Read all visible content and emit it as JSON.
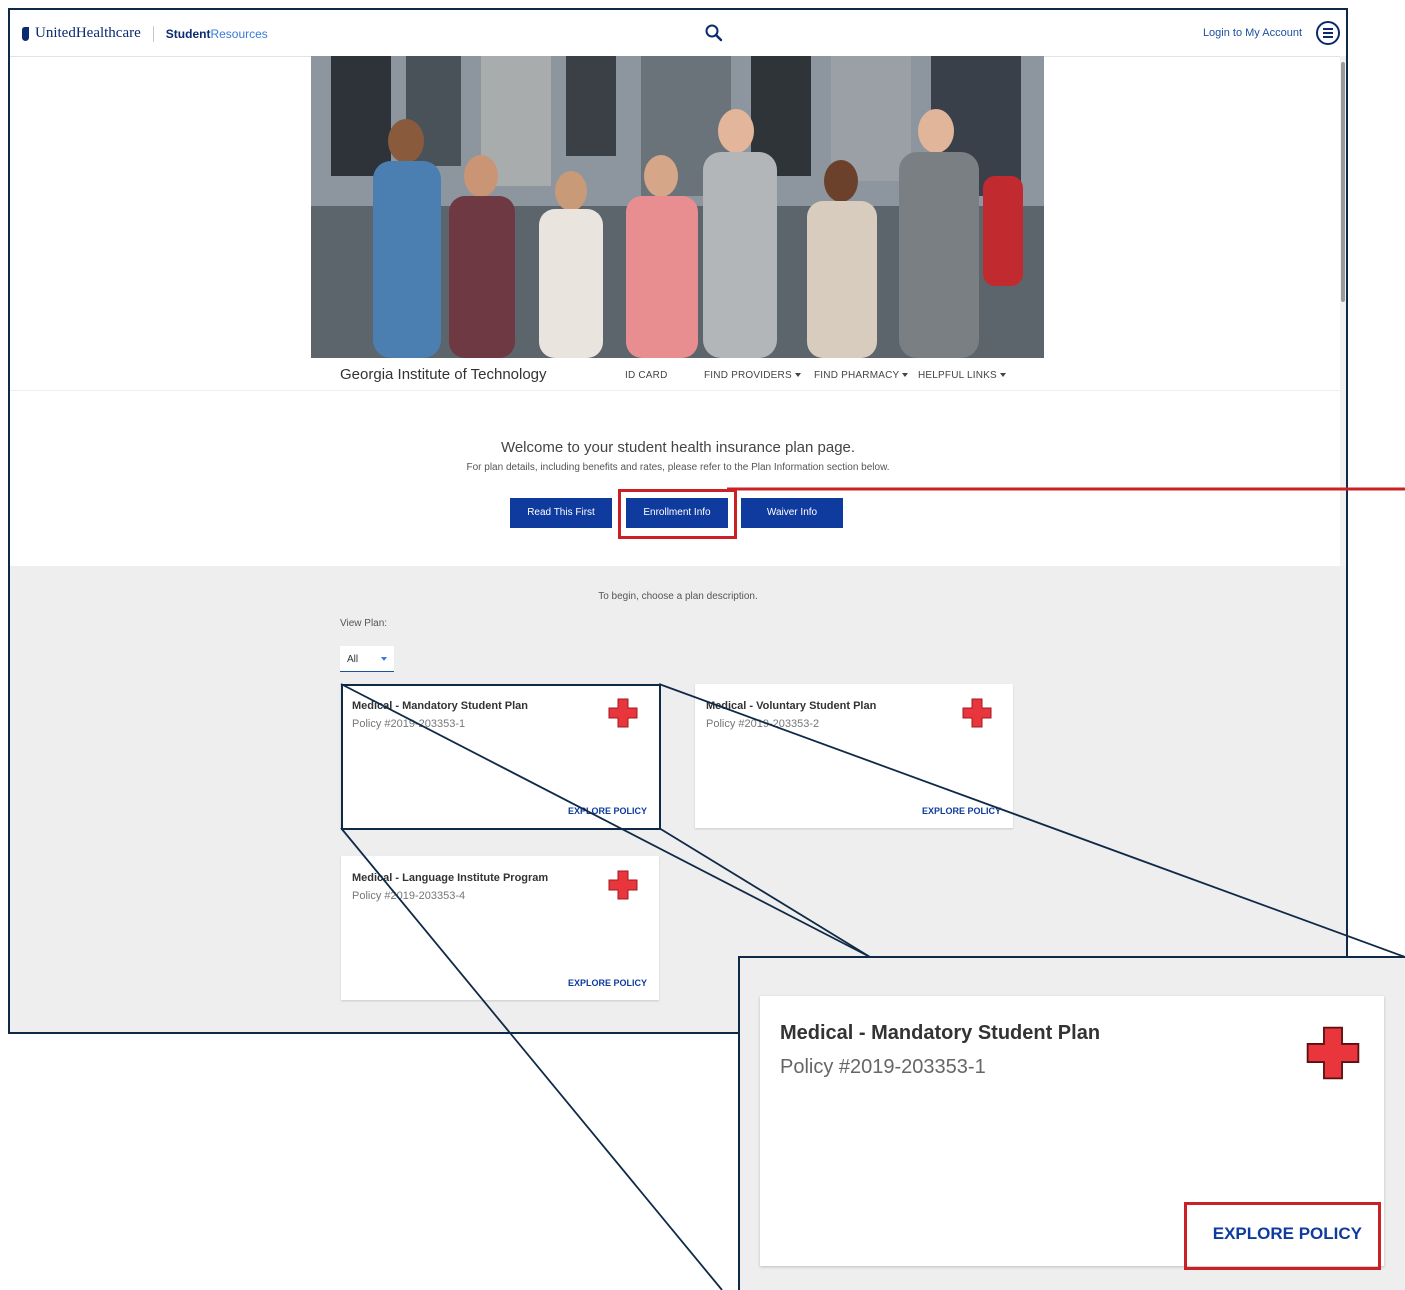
{
  "header": {
    "logo_text": "UnitedHealthcare",
    "logo_student": "Student",
    "logo_resources": "Resources",
    "login_label": "Login to My Account"
  },
  "subnav": {
    "school": "Georgia Institute of Technology",
    "items": [
      "ID CARD",
      "FIND PROVIDERS",
      "FIND PHARMACY",
      "HELPFUL LINKS"
    ]
  },
  "welcome": {
    "heading": "Welcome to your student health insurance plan page.",
    "details": "For plan details, including benefits and rates, please refer to the Plan Information section below."
  },
  "buttons": {
    "read_first": "Read This First",
    "enrollment": "Enrollment Info",
    "waiver": "Waiver Info"
  },
  "plans": {
    "begin_text": "To begin, choose a plan description.",
    "view_label": "View Plan:",
    "filter_value": "All",
    "explore_label": "EXPLORE POLICY",
    "cards": [
      {
        "title": "Medical - Mandatory Student Plan",
        "policy": "Policy #2019-203353-1"
      },
      {
        "title": "Medical - Voluntary Student Plan",
        "policy": "Policy #2019-203353-2"
      },
      {
        "title": "Medical - Language Institute Program",
        "policy": "Policy #2019-203353-4"
      }
    ]
  },
  "zoom": {
    "title": "Medical - Mandatory Student Plan",
    "policy": "Policy #2019-203353-1",
    "explore": "EXPLORE POLICY"
  },
  "colors": {
    "brand_navy": "#0b2a6f",
    "button_blue": "#0f3b9e",
    "highlight_red": "#cc2027",
    "cross_red": "#e8363c"
  },
  "icons": [
    "search-icon",
    "menu-icon",
    "medical-cross-icon",
    "caret-down-icon"
  ]
}
